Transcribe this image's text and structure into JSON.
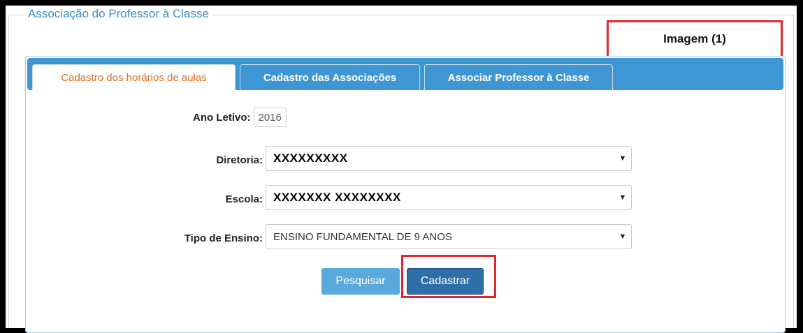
{
  "fieldset": {
    "legend": "Associação do Professor à Classe"
  },
  "annotation": {
    "label": "Imagem (1)"
  },
  "tabs": [
    {
      "label": "Cadastro dos horários de aulas",
      "active": true
    },
    {
      "label": "Cadastro das Associações",
      "active": false
    },
    {
      "label": "Associar Professor à Classe",
      "active": false
    }
  ],
  "form": {
    "ano_letivo": {
      "label": "Ano Letivo:",
      "value": "2016"
    },
    "diretoria": {
      "label": "Diretoria:",
      "value": "XXXXXXXXX"
    },
    "escola": {
      "label": "Escola:",
      "value": "XXXXXXX XXXXXXXX"
    },
    "tipo_ensino": {
      "label": "Tipo de Ensino:",
      "value": "ENSINO FUNDAMENTAL DE 9 ANOS"
    }
  },
  "buttons": {
    "pesquisar": "Pesquisar",
    "cadastrar": "Cadastrar"
  },
  "colors": {
    "accent": "#3f96d4",
    "active_tab_text": "#e16d1e",
    "highlight": "#e3262b"
  }
}
